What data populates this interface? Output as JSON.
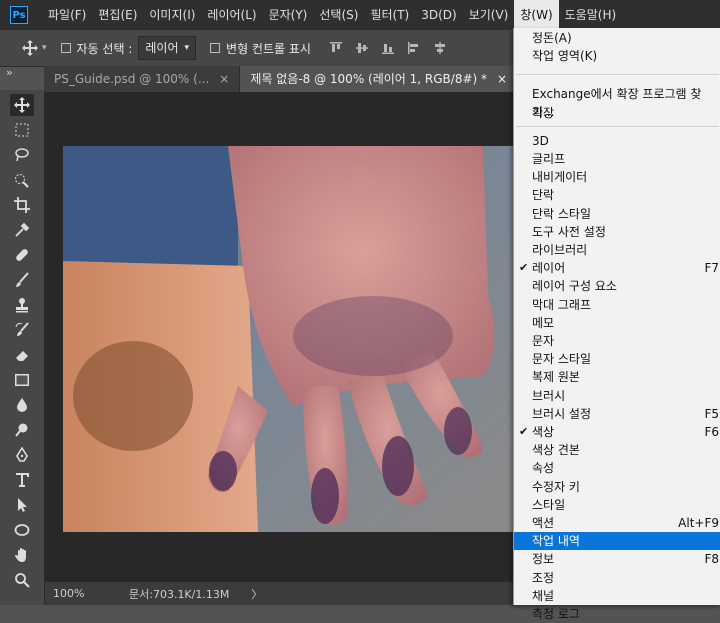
{
  "app": {
    "logo": "Ps"
  },
  "menubar": {
    "items": [
      "파일(F)",
      "편집(E)",
      "이미지(I)",
      "레이어(L)",
      "문자(Y)",
      "선택(S)",
      "필터(T)",
      "3D(D)",
      "보기(V)",
      "창(W)",
      "도움말(H)"
    ]
  },
  "options": {
    "auto_select_label": "자동 선택 :",
    "auto_select_value": "레이어",
    "transform_controls_label": "변형 컨트롤 표시"
  },
  "tabs": [
    {
      "label": "PS_Guide.psd @ 100% (...",
      "close": "×"
    },
    {
      "label": "제목 없음-8 @ 100% (레이어 1, RGB/8#) *",
      "close": "×"
    },
    {
      "label": "제목",
      "close": ""
    }
  ],
  "collapse_glyph": "»",
  "status": {
    "zoom": "100%",
    "doc": "문서:703.1K/1.13M",
    "arrow": "〉"
  },
  "window_menu": {
    "items": [
      {
        "label": "정돈(A)",
        "shortcut": "",
        "checked": false
      },
      {
        "label": "작업 영역(K)",
        "shortcut": "",
        "checked": false
      },
      {
        "label": "Exchange에서 확장 프로그램 찾기...",
        "shortcut": "",
        "checked": false
      },
      {
        "label": "확장",
        "shortcut": "",
        "checked": false
      },
      {
        "label": "3D",
        "shortcut": "",
        "checked": false
      },
      {
        "label": "글리프",
        "shortcut": "",
        "checked": false
      },
      {
        "label": "내비게이터",
        "shortcut": "",
        "checked": false
      },
      {
        "label": "단락",
        "shortcut": "",
        "checked": false
      },
      {
        "label": "단락 스타일",
        "shortcut": "",
        "checked": false
      },
      {
        "label": "도구 사전 설정",
        "shortcut": "",
        "checked": false
      },
      {
        "label": "라이브러리",
        "shortcut": "",
        "checked": false
      },
      {
        "label": "레이어",
        "shortcut": "F7",
        "checked": true
      },
      {
        "label": "레이어 구성 요소",
        "shortcut": "",
        "checked": false
      },
      {
        "label": "막대 그래프",
        "shortcut": "",
        "checked": false
      },
      {
        "label": "메모",
        "shortcut": "",
        "checked": false
      },
      {
        "label": "문자",
        "shortcut": "",
        "checked": false
      },
      {
        "label": "문자 스타일",
        "shortcut": "",
        "checked": false
      },
      {
        "label": "복제 원본",
        "shortcut": "",
        "checked": false
      },
      {
        "label": "브러시",
        "shortcut": "",
        "checked": false
      },
      {
        "label": "브러시 설정",
        "shortcut": "F5",
        "checked": false
      },
      {
        "label": "색상",
        "shortcut": "F6",
        "checked": true
      },
      {
        "label": "색상 견본",
        "shortcut": "",
        "checked": false
      },
      {
        "label": "속성",
        "shortcut": "",
        "checked": false
      },
      {
        "label": "수정자 키",
        "shortcut": "",
        "checked": false
      },
      {
        "label": "스타일",
        "shortcut": "",
        "checked": false
      },
      {
        "label": "액션",
        "shortcut": "Alt+F9",
        "checked": false
      },
      {
        "label": "작업 내역",
        "shortcut": "",
        "checked": false,
        "highlighted": true
      },
      {
        "label": "정보",
        "shortcut": "F8",
        "checked": false
      },
      {
        "label": "조정",
        "shortcut": "",
        "checked": false
      },
      {
        "label": "채널",
        "shortcut": "",
        "checked": false
      },
      {
        "label": "측정 로그",
        "shortcut": "",
        "checked": false
      }
    ],
    "check_glyph": "✔"
  },
  "colors": {
    "accent": "#0b74d9",
    "menubar": "#2f2f2f",
    "panel": "#474747",
    "canvas_bg": "#282828"
  }
}
